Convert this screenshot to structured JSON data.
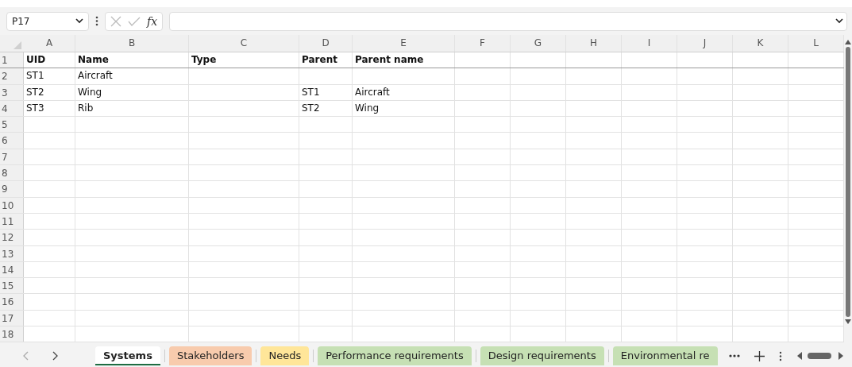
{
  "name_box": {
    "value": "P17"
  },
  "formula_bar": {
    "fx": "fx"
  },
  "columns": [
    "A",
    "B",
    "C",
    "D",
    "E",
    "F",
    "G",
    "H",
    "I",
    "J",
    "K",
    "L"
  ],
  "rows": [
    {
      "number": "1",
      "kind": "header",
      "cells": {
        "A": "UID",
        "B": "Name",
        "C": "Type",
        "D": "Parent",
        "E": "Parent name"
      }
    },
    {
      "number": "2",
      "kind": "data",
      "cells": {
        "A": "ST1",
        "B": "Aircraft"
      }
    },
    {
      "number": "3",
      "kind": "data",
      "cells": {
        "A": "ST2",
        "B": "Wing",
        "D": "ST1",
        "E": "Aircraft"
      }
    },
    {
      "number": "4",
      "kind": "data",
      "cells": {
        "A": "ST3",
        "B": "Rib",
        "D": "ST2",
        "E": "Wing"
      }
    },
    {
      "number": "5",
      "kind": "data",
      "cells": {}
    },
    {
      "number": "6",
      "kind": "data",
      "cells": {}
    },
    {
      "number": "7",
      "kind": "data",
      "cells": {}
    },
    {
      "number": "8",
      "kind": "data",
      "cells": {}
    },
    {
      "number": "9",
      "kind": "data",
      "cells": {}
    },
    {
      "number": "10",
      "kind": "data",
      "cells": {}
    },
    {
      "number": "11",
      "kind": "data",
      "cells": {}
    },
    {
      "number": "12",
      "kind": "data",
      "cells": {}
    },
    {
      "number": "13",
      "kind": "data",
      "cells": {}
    },
    {
      "number": "14",
      "kind": "data",
      "cells": {}
    },
    {
      "number": "15",
      "kind": "data",
      "cells": {}
    },
    {
      "number": "16",
      "kind": "data",
      "cells": {}
    },
    {
      "number": "17",
      "kind": "data",
      "cells": {}
    },
    {
      "number": "18",
      "kind": "data",
      "cells": {}
    }
  ],
  "sheet_tabs": [
    {
      "label": "Systems",
      "selected": true
    },
    {
      "label": "Stakeholders",
      "selected": false,
      "color": "#f8cbad"
    },
    {
      "label": "Needs",
      "selected": false,
      "color": "#ffe699"
    },
    {
      "label": "Performance requirements",
      "selected": false,
      "color": "#c6e0b4"
    },
    {
      "label": "Design requirements",
      "selected": false,
      "color": "#c6e0b4"
    },
    {
      "label": "Environmental re",
      "selected": false,
      "color": "#c6e0b4"
    }
  ]
}
